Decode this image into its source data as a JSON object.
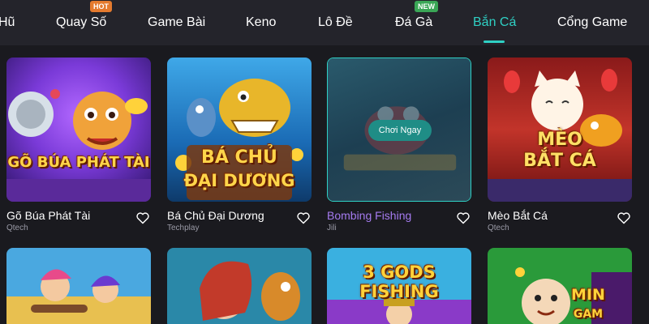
{
  "nav": {
    "items": [
      {
        "label": "Hũ"
      },
      {
        "label": "Quay Số",
        "badge": "HOT"
      },
      {
        "label": "Game Bài"
      },
      {
        "label": "Keno"
      },
      {
        "label": "Lô Đề"
      },
      {
        "label": "Đá Gà",
        "badge": "NEW"
      },
      {
        "label": "Bắn Cá",
        "active": true
      },
      {
        "label": "Cổng Game"
      }
    ],
    "accent": "#2fd0c4"
  },
  "games": [
    {
      "name": "Gõ Búa Phát Tài",
      "provider": "Qtech",
      "art_text": [
        "GÕ BÚA PHÁT TÀI"
      ]
    },
    {
      "name": "Bá Chủ Đại Dương",
      "provider": "Techplay",
      "art_text": [
        "BÁ CHỦ",
        "ĐẠI DƯƠNG"
      ]
    },
    {
      "name": "Bombing Fishing",
      "provider": "Jili",
      "hovered": true,
      "play_label": "Chơi Ngay"
    },
    {
      "name": "Mèo Bắt Cá",
      "provider": "Qtech",
      "art_text": [
        "MÈO",
        "BẮT CÁ"
      ]
    },
    {
      "name": "",
      "provider": ""
    },
    {
      "name": "",
      "provider": ""
    },
    {
      "name": "",
      "provider": "",
      "art_text": [
        "3 GODS FISHING"
      ]
    },
    {
      "name": "",
      "provider": "",
      "art_text": [
        "MIN",
        "GAM"
      ]
    }
  ],
  "colors": {
    "background": "#1a1a1f",
    "nav_background": "#24242b",
    "hot_badge": "#e47a2e",
    "new_badge": "#3aa656",
    "hovered_title": "#a57bf0"
  },
  "icons": {
    "favorite": "heart-outline-icon"
  }
}
